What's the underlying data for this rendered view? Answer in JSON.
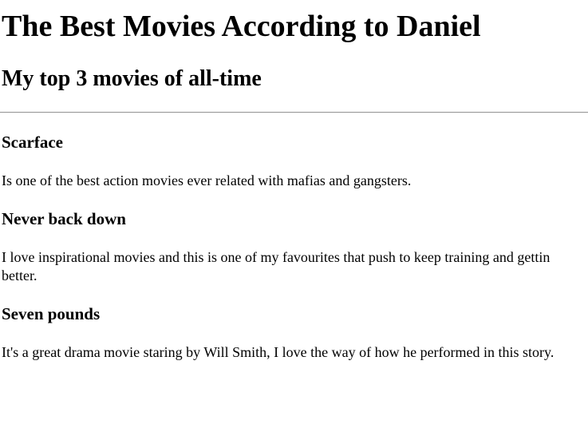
{
  "page": {
    "title": "The Best Movies According to Daniel",
    "subtitle": "My top 3 movies of all-time"
  },
  "movies": [
    {
      "title": "Scarface",
      "description": "Is one of the best action movies ever related with mafias and gangsters."
    },
    {
      "title": "Never back down",
      "description": "I love inspirational movies and this is one of my favourites that push to keep training and gettin better."
    },
    {
      "title": "Seven pounds",
      "description": "It's a great drama movie staring by Will Smith, I love the way of how he performed in this story."
    }
  ]
}
